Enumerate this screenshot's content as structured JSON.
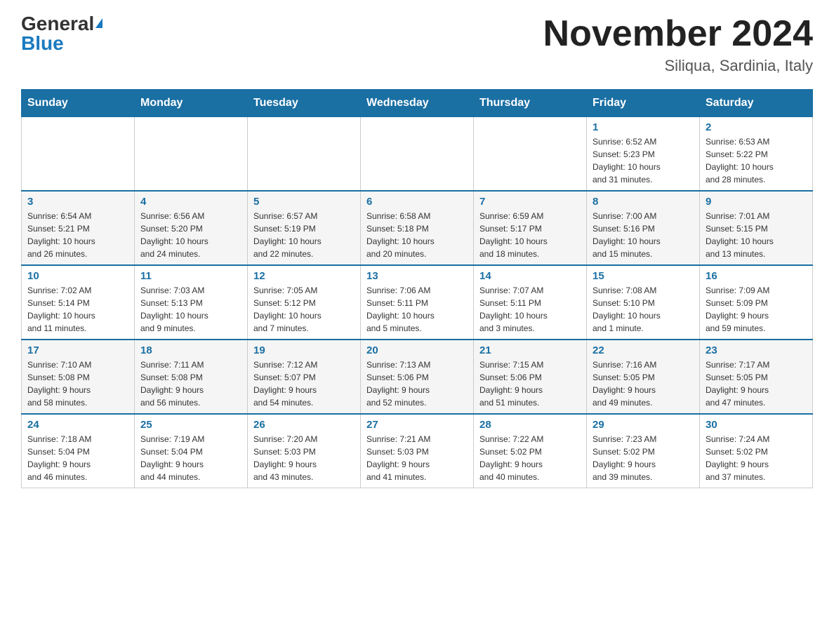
{
  "header": {
    "logo_general": "General",
    "logo_blue": "Blue",
    "month_title": "November 2024",
    "location": "Siliqua, Sardinia, Italy"
  },
  "days_of_week": [
    "Sunday",
    "Monday",
    "Tuesday",
    "Wednesday",
    "Thursday",
    "Friday",
    "Saturday"
  ],
  "weeks": [
    {
      "days": [
        {
          "number": "",
          "info": ""
        },
        {
          "number": "",
          "info": ""
        },
        {
          "number": "",
          "info": ""
        },
        {
          "number": "",
          "info": ""
        },
        {
          "number": "",
          "info": ""
        },
        {
          "number": "1",
          "info": "Sunrise: 6:52 AM\nSunset: 5:23 PM\nDaylight: 10 hours\nand 31 minutes."
        },
        {
          "number": "2",
          "info": "Sunrise: 6:53 AM\nSunset: 5:22 PM\nDaylight: 10 hours\nand 28 minutes."
        }
      ]
    },
    {
      "days": [
        {
          "number": "3",
          "info": "Sunrise: 6:54 AM\nSunset: 5:21 PM\nDaylight: 10 hours\nand 26 minutes."
        },
        {
          "number": "4",
          "info": "Sunrise: 6:56 AM\nSunset: 5:20 PM\nDaylight: 10 hours\nand 24 minutes."
        },
        {
          "number": "5",
          "info": "Sunrise: 6:57 AM\nSunset: 5:19 PM\nDaylight: 10 hours\nand 22 minutes."
        },
        {
          "number": "6",
          "info": "Sunrise: 6:58 AM\nSunset: 5:18 PM\nDaylight: 10 hours\nand 20 minutes."
        },
        {
          "number": "7",
          "info": "Sunrise: 6:59 AM\nSunset: 5:17 PM\nDaylight: 10 hours\nand 18 minutes."
        },
        {
          "number": "8",
          "info": "Sunrise: 7:00 AM\nSunset: 5:16 PM\nDaylight: 10 hours\nand 15 minutes."
        },
        {
          "number": "9",
          "info": "Sunrise: 7:01 AM\nSunset: 5:15 PM\nDaylight: 10 hours\nand 13 minutes."
        }
      ]
    },
    {
      "days": [
        {
          "number": "10",
          "info": "Sunrise: 7:02 AM\nSunset: 5:14 PM\nDaylight: 10 hours\nand 11 minutes."
        },
        {
          "number": "11",
          "info": "Sunrise: 7:03 AM\nSunset: 5:13 PM\nDaylight: 10 hours\nand 9 minutes."
        },
        {
          "number": "12",
          "info": "Sunrise: 7:05 AM\nSunset: 5:12 PM\nDaylight: 10 hours\nand 7 minutes."
        },
        {
          "number": "13",
          "info": "Sunrise: 7:06 AM\nSunset: 5:11 PM\nDaylight: 10 hours\nand 5 minutes."
        },
        {
          "number": "14",
          "info": "Sunrise: 7:07 AM\nSunset: 5:11 PM\nDaylight: 10 hours\nand 3 minutes."
        },
        {
          "number": "15",
          "info": "Sunrise: 7:08 AM\nSunset: 5:10 PM\nDaylight: 10 hours\nand 1 minute."
        },
        {
          "number": "16",
          "info": "Sunrise: 7:09 AM\nSunset: 5:09 PM\nDaylight: 9 hours\nand 59 minutes."
        }
      ]
    },
    {
      "days": [
        {
          "number": "17",
          "info": "Sunrise: 7:10 AM\nSunset: 5:08 PM\nDaylight: 9 hours\nand 58 minutes."
        },
        {
          "number": "18",
          "info": "Sunrise: 7:11 AM\nSunset: 5:08 PM\nDaylight: 9 hours\nand 56 minutes."
        },
        {
          "number": "19",
          "info": "Sunrise: 7:12 AM\nSunset: 5:07 PM\nDaylight: 9 hours\nand 54 minutes."
        },
        {
          "number": "20",
          "info": "Sunrise: 7:13 AM\nSunset: 5:06 PM\nDaylight: 9 hours\nand 52 minutes."
        },
        {
          "number": "21",
          "info": "Sunrise: 7:15 AM\nSunset: 5:06 PM\nDaylight: 9 hours\nand 51 minutes."
        },
        {
          "number": "22",
          "info": "Sunrise: 7:16 AM\nSunset: 5:05 PM\nDaylight: 9 hours\nand 49 minutes."
        },
        {
          "number": "23",
          "info": "Sunrise: 7:17 AM\nSunset: 5:05 PM\nDaylight: 9 hours\nand 47 minutes."
        }
      ]
    },
    {
      "days": [
        {
          "number": "24",
          "info": "Sunrise: 7:18 AM\nSunset: 5:04 PM\nDaylight: 9 hours\nand 46 minutes."
        },
        {
          "number": "25",
          "info": "Sunrise: 7:19 AM\nSunset: 5:04 PM\nDaylight: 9 hours\nand 44 minutes."
        },
        {
          "number": "26",
          "info": "Sunrise: 7:20 AM\nSunset: 5:03 PM\nDaylight: 9 hours\nand 43 minutes."
        },
        {
          "number": "27",
          "info": "Sunrise: 7:21 AM\nSunset: 5:03 PM\nDaylight: 9 hours\nand 41 minutes."
        },
        {
          "number": "28",
          "info": "Sunrise: 7:22 AM\nSunset: 5:02 PM\nDaylight: 9 hours\nand 40 minutes."
        },
        {
          "number": "29",
          "info": "Sunrise: 7:23 AM\nSunset: 5:02 PM\nDaylight: 9 hours\nand 39 minutes."
        },
        {
          "number": "30",
          "info": "Sunrise: 7:24 AM\nSunset: 5:02 PM\nDaylight: 9 hours\nand 37 minutes."
        }
      ]
    }
  ]
}
